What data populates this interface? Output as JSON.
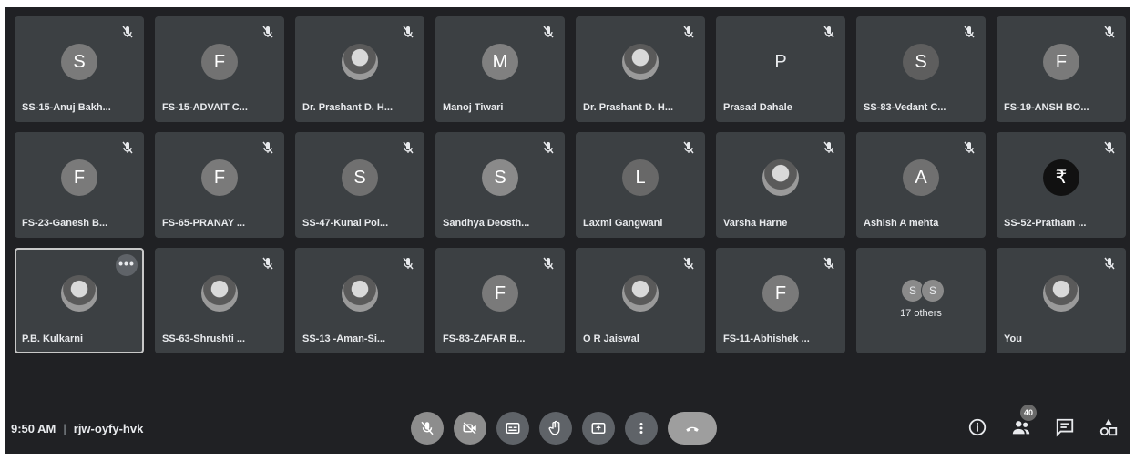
{
  "meeting": {
    "time": "9:50 AM",
    "separator": "|",
    "code": "rjw-oyfy-hvk"
  },
  "participants": [
    {
      "name": "SS-15-Anuj Bakh...",
      "initial": "S",
      "color": "#7a7a7a",
      "muted": true
    },
    {
      "name": "FS-15-ADVAIT C...",
      "initial": "F",
      "color": "#727272",
      "muted": true
    },
    {
      "name": "Dr. Prashant D. H...",
      "initial": "",
      "color": "#8e8e8e",
      "muted": true,
      "photo": true
    },
    {
      "name": "Manoj Tiwari",
      "initial": "M",
      "color": "#808080",
      "muted": true
    },
    {
      "name": "Dr. Prashant D. H...",
      "initial": "",
      "color": "#8e8e8e",
      "muted": true,
      "photo": true
    },
    {
      "name": "Prasad Dahale",
      "initial": "P",
      "color": "transparent",
      "muted": true
    },
    {
      "name": "SS-83-Vedant C...",
      "initial": "S",
      "color": "#5e5e5e",
      "muted": true
    },
    {
      "name": "FS-19-ANSH BO...",
      "initial": "F",
      "color": "#7a7a7a",
      "muted": true
    },
    {
      "name": "FS-23-Ganesh B...",
      "initial": "F",
      "color": "#7a7a7a",
      "muted": true
    },
    {
      "name": "FS-65-PRANAY ...",
      "initial": "F",
      "color": "#7a7a7a",
      "muted": true
    },
    {
      "name": "SS-47-Kunal Pol...",
      "initial": "S",
      "color": "#707070",
      "muted": true
    },
    {
      "name": "Sandhya Deosth...",
      "initial": "S",
      "color": "#8a8a8a",
      "muted": true
    },
    {
      "name": "Laxmi Gangwani",
      "initial": "L",
      "color": "#686868",
      "muted": true
    },
    {
      "name": "Varsha Harne",
      "initial": "",
      "color": "#9a9a9a",
      "muted": true,
      "photo": true
    },
    {
      "name": "Ashish A mehta",
      "initial": "A",
      "color": "#707070",
      "muted": true
    },
    {
      "name": "SS-52-Pratham ...",
      "initial": "₹",
      "color": "#111111",
      "muted": true
    },
    {
      "name": "P.B. Kulkarni",
      "initial": "",
      "color": "#8e8e8e",
      "muted": false,
      "photo": true,
      "active": true
    },
    {
      "name": "SS-63-Shrushti ...",
      "initial": "",
      "color": "#8e8e8e",
      "muted": true,
      "photo": true
    },
    {
      "name": "SS-13 -Aman-Si...",
      "initial": "",
      "color": "#9a9a9a",
      "muted": true,
      "photo": true
    },
    {
      "name": "FS-83-ZAFAR B...",
      "initial": "F",
      "color": "#7a7a7a",
      "muted": true
    },
    {
      "name": "O R Jaiswal",
      "initial": "",
      "color": "#9a9a9a",
      "muted": true,
      "photo": true
    },
    {
      "name": "FS-11-Abhishek ...",
      "initial": "F",
      "color": "#7a7a7a",
      "muted": true
    },
    {
      "others": true,
      "label": "17 others",
      "minis": [
        "S",
        "S"
      ]
    },
    {
      "name": "You",
      "initial": "",
      "color": "#bdbdbd",
      "muted": true,
      "photo": true
    }
  ],
  "controls": [
    {
      "name": "mic-toggle-button",
      "icon": "mic-off-icon",
      "light": true
    },
    {
      "name": "camera-toggle-button",
      "icon": "camera-off-icon",
      "light": true
    },
    {
      "name": "captions-button",
      "icon": "captions-icon"
    },
    {
      "name": "raise-hand-button",
      "icon": "hand-icon"
    },
    {
      "name": "present-screen-button",
      "icon": "present-icon"
    },
    {
      "name": "more-options-button",
      "icon": "more-vert-icon"
    },
    {
      "name": "leave-call-button",
      "icon": "call-end-icon",
      "end": true
    }
  ],
  "side": {
    "people_count": "40"
  }
}
